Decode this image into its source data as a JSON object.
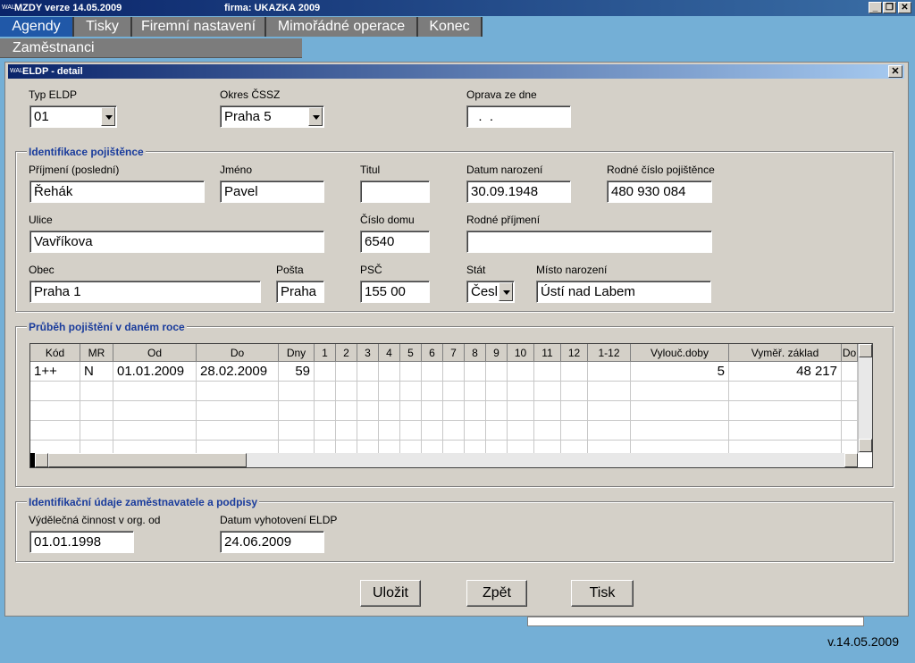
{
  "app": {
    "logo": "WAL",
    "title": "MZDY   verze 14.05.2009",
    "firma": "firma: UKAZKA 2009",
    "minimize": "_",
    "restore": "❐",
    "close": "✕"
  },
  "menu": {
    "items": [
      "Agendy",
      "Tisky",
      "Firemní nastavení",
      "Mimořádné operace",
      "Konec"
    ],
    "sub": "Zaměstnanci"
  },
  "dialog": {
    "logo": "WAL",
    "title": "ELDP - detail",
    "close": "✕",
    "top": {
      "typ_label": "Typ ELDP",
      "typ_value": "01",
      "okres_label": "Okres ČSSZ",
      "okres_value": "Praha 5",
      "oprava_label": "Oprava ze dne",
      "oprava_value": "  .  ."
    },
    "ident": {
      "title": "Identifikace pojištěnce",
      "prijmeni_label": "Příjmení (poslední)",
      "prijmeni_value": "Řehák",
      "jmeno_label": "Jméno",
      "jmeno_value": "Pavel",
      "titul_label": "Titul",
      "titul_value": "",
      "narozeni_label": "Datum narození",
      "narozeni_value": "30.09.1948",
      "rc_label": "Rodné číslo pojištěnce",
      "rc_value": "480 930 084",
      "ulice_label": "Ulice",
      "ulice_value": "Vavříkova",
      "cislo_label": "Číslo domu",
      "cislo_value": "6540",
      "rodne_prijmeni_label": "Rodné příjmení",
      "rodne_prijmeni_value": "",
      "obec_label": "Obec",
      "obec_value": "Praha 1",
      "posta_label": "Pošta",
      "posta_value": "Praha",
      "psc_label": "PSČ",
      "psc_value": "155 00",
      "stat_label": "Stát",
      "stat_value": "Česl",
      "misto_label": "Místo narození",
      "misto_value": "Ústí nad Labem"
    },
    "prubeh": {
      "title": "Průběh pojištění v daném roce",
      "columns": [
        "Kód",
        "MR",
        "Od",
        "Do",
        "Dny",
        "1",
        "2",
        "3",
        "4",
        "5",
        "6",
        "7",
        "8",
        "9",
        "10",
        "11",
        "12",
        "1-12",
        "Vylouč.doby",
        "Vyměř. základ",
        "Do"
      ],
      "rows": [
        {
          "kod": "1++",
          "mr": "N",
          "od": "01.01.2009",
          "do": "28.02.2009",
          "dny": "59",
          "vylouc": "5",
          "zaklad": "48 217"
        }
      ]
    },
    "zam": {
      "title": "Identifikační údaje zaměstnavatele a podpisy",
      "cinnost_label": "Výdělečná činnost v org. od",
      "cinnost_value": "01.01.1998",
      "vyhotoveni_label": "Datum vyhotovení ELDP",
      "vyhotoveni_value": "24.06.2009"
    },
    "buttons": {
      "ulozit": "Uložit",
      "zpet": "Zpět",
      "tisk": "Tisk"
    }
  },
  "version": "v.14.05.2009"
}
